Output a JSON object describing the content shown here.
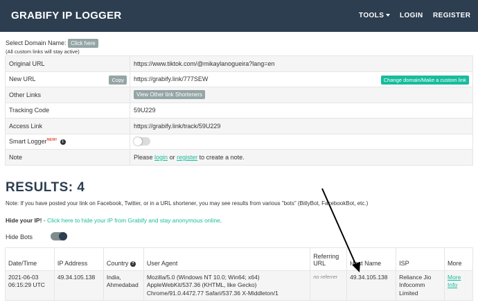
{
  "navbar": {
    "brand": "GRABIFY IP LOGGER",
    "tools": "TOOLS",
    "login": "LOGIN",
    "register": "REGISTER"
  },
  "domain": {
    "label": "Select Domain Name:",
    "button": "Click here",
    "note": "(All custom links will stay active)"
  },
  "info": {
    "original_url_label": "Original URL",
    "original_url": "https://www.tiktok.com/@mikaylanogueira?lang=en",
    "new_url_label": "New URL",
    "copy_button": "Copy",
    "new_url": "https://grabify.link/777SEW",
    "change_domain_button": "Change domain/Make a custom link",
    "other_links_label": "Other Links",
    "other_links_button": "View Other link Shorteners",
    "tracking_code_label": "Tracking Code",
    "tracking_code": "59U229",
    "access_link_label": "Access Link",
    "access_link": "https://grabify.link/track/59U229",
    "smart_logger_label": "Smart Logger",
    "smart_logger_badge": "NEW!",
    "note_label": "Note",
    "note_please": "Please",
    "note_login": "login",
    "note_or": "or",
    "note_register": "register",
    "note_rest": "to create a note."
  },
  "results": {
    "title": "RESULTS: 4",
    "note": "Note: If you have posted your link on Facebook, Twitter, or in a URL shortener, you may see results from various \"bots\" (BitlyBot, FacebookBot, etc.)",
    "hide_ip_bold": "Hide your IP!",
    "hide_ip_dash": " - ",
    "hide_ip_link": "Click here to hide your IP from Grabify and stay anonymous online",
    "hide_ip_end": ".",
    "hide_bots_label": "Hide Bots",
    "columns": {
      "datetime": "Date/Time",
      "ip": "IP Address",
      "country": "Country",
      "user_agent": "User Agent",
      "referring_url": "Referring URL",
      "host_name": "Host Name",
      "isp": "ISP",
      "more": "More"
    },
    "rows": [
      {
        "datetime": "2021-06-03 06:15:29 UTC",
        "ip": "49.34.105.138",
        "country": "India, Ahmedabad",
        "user_agent": "Mozilla/5.0 (Windows NT 10.0; Win64; x64) AppleWebKit/537.36 (KHTML, like Gecko) Chrome/91.0.4472.77 Safari/537.36 X-Middleton/1",
        "referring_url": "no referrer",
        "host_name": "49.34.105.138",
        "isp": "Reliance Jio Infocomm Limited",
        "more": "More Info"
      }
    ]
  },
  "colors": {
    "navbar": "#2c3e50",
    "accent_green": "#18bc9c",
    "button_gray": "#95a5a6"
  }
}
